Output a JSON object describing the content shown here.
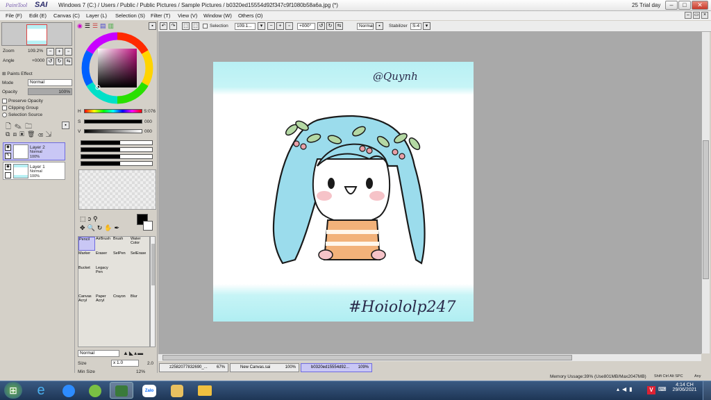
{
  "window": {
    "app_logo": "PaintTool SAI",
    "title": "Windows 7 (C:) / Users / Public / Public Pictures / Sample Pictures / b0320ed15554d92f347c9f1080b58a6a.jpg (*)",
    "trial": "25 Trial day"
  },
  "menu": [
    "File (F)",
    "Edit (E)",
    "Canvas (C)",
    "Layer (L)",
    "Selection (S)",
    "Filter (T)",
    "View (V)",
    "Window (W)",
    "Others (O)"
  ],
  "navigator": {
    "zoom_label": "Zoom",
    "zoom_value": "109.2%",
    "angle_label": "Angle",
    "angle_value": "+0000"
  },
  "layer_props": {
    "effect_label": "Paints Effect",
    "mode_label": "Mode",
    "mode_value": "Normal",
    "opacity_label": "Opacity",
    "opacity_value": "100%",
    "preserve_opacity": "Preserve Opacity",
    "clipping_group": "Clipping Group",
    "selection_source": "Selection Source"
  },
  "layers": [
    {
      "name": "Layer 2",
      "mode": "Normal",
      "opacity": "100%",
      "selected": true
    },
    {
      "name": "Layer 1",
      "mode": "Normal",
      "opacity": "100%",
      "selected": false
    }
  ],
  "color": {
    "h_label": "H",
    "h_value": "S:076",
    "s_label": "S",
    "s_value": "000",
    "v_label": "V",
    "v_value": "000"
  },
  "tools": [
    [
      "Pencil",
      "AirBrush",
      "Brush",
      "Water Color"
    ],
    [
      "Marker",
      "Eraser",
      "SelPen",
      "SelErase"
    ],
    [
      "Bucket",
      "Legacy Pen",
      "",
      ""
    ],
    [
      "Canvas Acryl",
      "Paper Acryl",
      "Crayon",
      "Blur"
    ]
  ],
  "brush": {
    "mode_value": "Normal",
    "size_label": "Size",
    "size_mult": "x 1.0",
    "size_value": "2.0",
    "min_size_label": "Min Size",
    "min_size_value": "12%"
  },
  "toolbar": {
    "selection_label": "Selection",
    "zoom_value": "109.1...",
    "angle_value": "+000°",
    "blend_value": "Normal",
    "stabilizer_label": "Stabilizer",
    "stabilizer_value": "S-4"
  },
  "artwork": {
    "signature": "@Quynh",
    "hashtag": "#Hoiololp247"
  },
  "doc_tabs": [
    {
      "name": "z2582077832690_...",
      "zoom": "67%",
      "active": false
    },
    {
      "name": "New Canvas.sai",
      "zoom": "100%",
      "active": false
    },
    {
      "name": "b0320ed15554d92...",
      "zoom": "109%",
      "active": true
    }
  ],
  "status": {
    "memory": "Memory Ussage:39% (Use801MB/Max2047MB)",
    "keys": "Shift Ctrl Alt SPC",
    "ime": "Any"
  },
  "taskbar": {
    "time": "4:14 CH",
    "date": "29/06/2021",
    "apps": [
      "start",
      "internet-explorer",
      "zoom",
      "coccoc",
      "paint-tool-sai",
      "zalo",
      "paint",
      "file-explorer"
    ]
  },
  "colors": {
    "selection_highlight": "#c9c7f5",
    "hair_blue": "#8fd8ea",
    "banner_cyan": "#b8f0f4"
  }
}
